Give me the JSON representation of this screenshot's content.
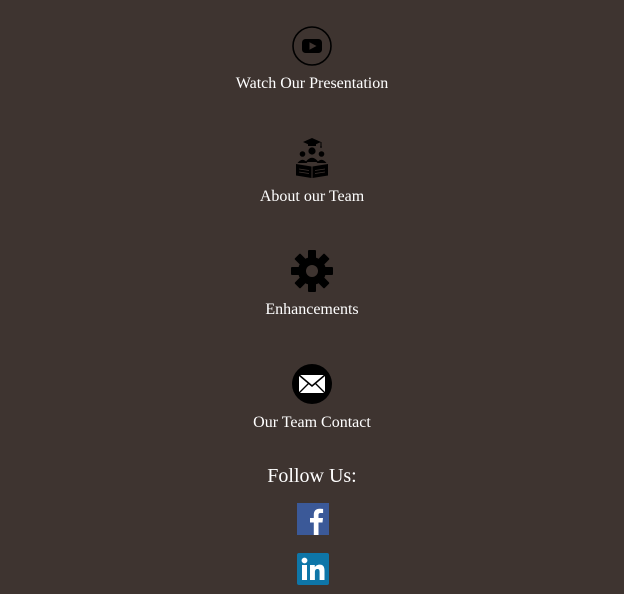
{
  "menu": {
    "items": [
      {
        "label": "Watch Our Presentation",
        "icon": "youtube-icon"
      },
      {
        "label": "About our Team",
        "icon": "team-graduation-icon"
      },
      {
        "label": "Enhancements",
        "icon": "gear-icon"
      },
      {
        "label": "Our Team Contact",
        "icon": "envelope-icon"
      }
    ]
  },
  "follow": {
    "heading": "Follow Us:",
    "networks": [
      {
        "name": "facebook",
        "icon": "facebook-icon",
        "color": "#3b5998"
      },
      {
        "name": "linkedin",
        "icon": "linkedin-icon",
        "color": "#0e76a8"
      }
    ]
  },
  "colors": {
    "background": "#3e3430",
    "text": "#ffffff",
    "icon": "#000000"
  }
}
